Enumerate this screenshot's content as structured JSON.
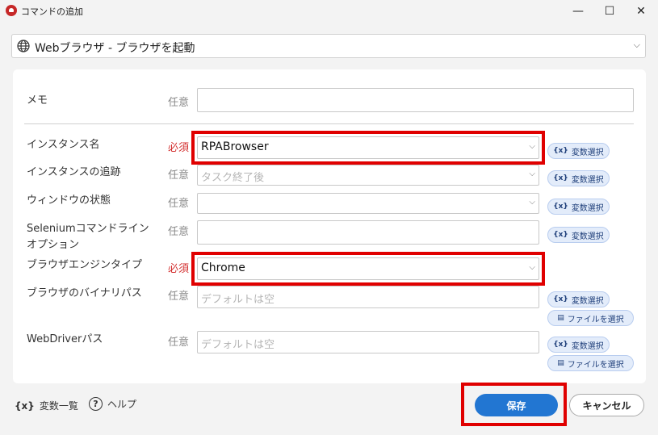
{
  "window": {
    "title": "コマンドの追加",
    "controls": {
      "minimize": "—",
      "maximize": "☐",
      "close": "✕"
    }
  },
  "action": {
    "label": "Webブラウザ - ブラウザを起動",
    "icon": "globe-icon"
  },
  "form": {
    "memo": {
      "label": "メモ",
      "tag": "任意",
      "value": ""
    },
    "instance_name": {
      "label": "インスタンス名",
      "tag": "必須",
      "value": "RPABrowser"
    },
    "instance_tracking": {
      "label": "インスタンスの追跡",
      "tag": "任意",
      "placeholder": "タスク終了後"
    },
    "window_state": {
      "label": "ウィンドウの状態",
      "tag": "任意",
      "value": ""
    },
    "selenium_options": {
      "label_line1": "Seleniumコマンドライン",
      "label_line2": "オプション",
      "tag": "任意",
      "value": ""
    },
    "browser_engine": {
      "label": "ブラウザエンジンタイプ",
      "tag": "必須",
      "value": "Chrome"
    },
    "browser_binary": {
      "label": "ブラウザのバイナリパス",
      "tag": "任意",
      "placeholder": "デフォルトは空"
    },
    "webdriver_path": {
      "label": "WebDriverパス",
      "tag": "任意",
      "placeholder": "デフォルトは空"
    }
  },
  "pills": {
    "variable": "変数選択",
    "variable_icon": "{x}",
    "file": "ファイルを選択"
  },
  "footer": {
    "variables_icon": "{x}",
    "variables_label": "変数一覧",
    "help_icon": "?",
    "help_label": "ヘルプ",
    "save": "保存",
    "cancel": "キャンセル"
  },
  "colors": {
    "primary": "#2276d2",
    "required": "#d32f2f",
    "highlight": "#e00000"
  }
}
